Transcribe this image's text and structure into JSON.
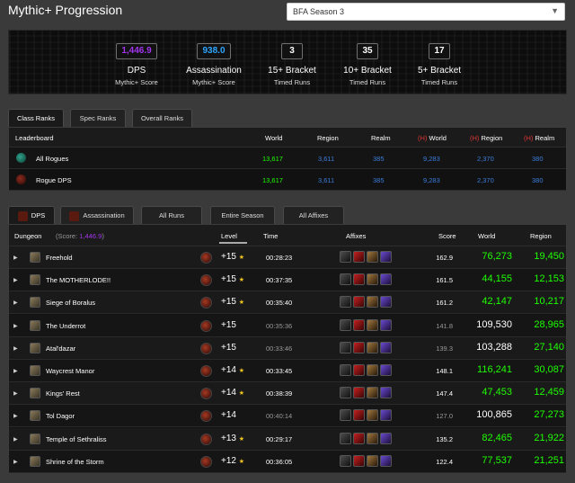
{
  "title": "Mythic+ Progression",
  "season": "BFA Season 3",
  "stats": [
    {
      "value": "1,446.9",
      "label": "DPS",
      "sub": "Mythic+ Score",
      "color": "#a335ee"
    },
    {
      "value": "938.0",
      "label": "Assassination",
      "sub": "Mythic+ Score",
      "color": "#2ea6ff"
    },
    {
      "value": "3",
      "label": "15+ Bracket",
      "sub": "Timed Runs",
      "color": "#ffffff"
    },
    {
      "value": "35",
      "label": "10+ Bracket",
      "sub": "Timed Runs",
      "color": "#ffffff"
    },
    {
      "value": "17",
      "label": "5+ Bracket",
      "sub": "Timed Runs",
      "color": "#ffffff"
    }
  ],
  "rank_tabs": [
    "Class Ranks",
    "Spec Ranks",
    "Overall Ranks"
  ],
  "leaderboard": {
    "headers": {
      "name": "Leaderboard",
      "world": "World",
      "region": "Region",
      "realm": "Realm",
      "h_prefix": "(H)",
      "h_world": "World",
      "h_region": "Region",
      "h_realm": "Realm"
    },
    "rows": [
      {
        "name": "All Rogues",
        "icon": "rogue-class-icon",
        "world": "13,617",
        "region": "3,611",
        "realm": "385",
        "h_world": "9,283",
        "h_region": "2,370",
        "h_realm": "380"
      },
      {
        "name": "Rogue DPS",
        "icon": "dps-role-icon",
        "world": "13,617",
        "region": "3,611",
        "realm": "385",
        "h_world": "9,283",
        "h_region": "2,370",
        "h_realm": "380"
      }
    ]
  },
  "run_tabs": [
    "DPS",
    "Assassination",
    "All Runs",
    "Entire Season",
    "All Affixes"
  ],
  "dungeons": {
    "headers": {
      "dungeon": "Dungeon",
      "score_label": "(Score:",
      "score_value": "1,446.9",
      "score_close": ")",
      "level": "Level",
      "time": "Time",
      "affixes": "Affixes",
      "score": "Score",
      "world": "World",
      "region": "Region"
    },
    "rows": [
      {
        "name": "Freehold",
        "level": "+15",
        "star": true,
        "time": "00:28:23",
        "score": "162.9",
        "world": "76,273",
        "region": "19,450",
        "timed": true
      },
      {
        "name": "The MOTHERLODE!!",
        "level": "+15",
        "star": true,
        "time": "00:37:35",
        "score": "161.5",
        "world": "44,155",
        "region": "12,153",
        "timed": true
      },
      {
        "name": "Siege of Boralus",
        "level": "+15",
        "star": true,
        "time": "00:35:40",
        "score": "161.2",
        "world": "42,147",
        "region": "10,217",
        "timed": true
      },
      {
        "name": "The Underrot",
        "level": "+15",
        "star": false,
        "time": "00:35:36",
        "score": "141.8",
        "world": "109,530",
        "region": "28,965",
        "timed": false
      },
      {
        "name": "Atal'dazar",
        "level": "+15",
        "star": false,
        "time": "00:33:46",
        "score": "139.3",
        "world": "103,288",
        "region": "27,140",
        "timed": false
      },
      {
        "name": "Waycrest Manor",
        "level": "+14",
        "star": true,
        "time": "00:33:45",
        "score": "148.1",
        "world": "116,241",
        "region": "30,087",
        "timed": true
      },
      {
        "name": "Kings' Rest",
        "level": "+14",
        "star": true,
        "time": "00:38:39",
        "score": "147.4",
        "world": "47,453",
        "region": "12,459",
        "timed": true
      },
      {
        "name": "Tol Dagor",
        "level": "+14",
        "star": false,
        "time": "00:40:14",
        "score": "127.0",
        "world": "100,865",
        "region": "27,273",
        "timed": false
      },
      {
        "name": "Temple of Sethraliss",
        "level": "+13",
        "star": true,
        "time": "00:29:17",
        "score": "135.2",
        "world": "82,465",
        "region": "21,922",
        "timed": true
      },
      {
        "name": "Shrine of the Storm",
        "level": "+12",
        "star": true,
        "time": "00:36:05",
        "score": "122.4",
        "world": "77,537",
        "region": "21,251",
        "timed": true
      }
    ]
  },
  "colors": {
    "green": "#1eff00",
    "white": "#ffffff",
    "blue": "#3b7ddb",
    "red": "#e03535",
    "gold": "#f3c623",
    "purple": "#a335ee"
  }
}
